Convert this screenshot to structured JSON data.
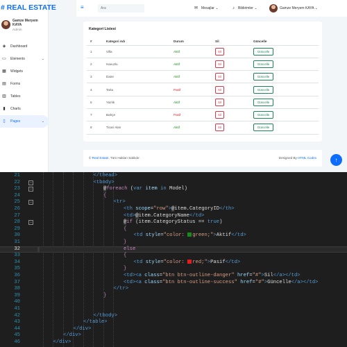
{
  "brand": "# REAL ESTATE",
  "sidebar": {
    "user_name": "Gamze Meryem KAYA",
    "user_role": "Admin",
    "items": [
      {
        "label": "Dashboard",
        "icon": "dashboard-icon"
      },
      {
        "label": "Elements",
        "icon": "laptop-icon"
      },
      {
        "label": "Widgets",
        "icon": "grid-icon"
      },
      {
        "label": "Forms",
        "icon": "keyboard-icon"
      },
      {
        "label": "Tables",
        "icon": "table-icon"
      },
      {
        "label": "Charts",
        "icon": "chart-icon"
      },
      {
        "label": "Pages",
        "icon": "file-icon"
      }
    ]
  },
  "topbar": {
    "search_placeholder": "Ara",
    "messages_label": "Mesajlar",
    "notifications_label": "Bildirimler",
    "user_label": "Gamze Meryem KAYA"
  },
  "card": {
    "title": "Kategori Listesi",
    "headers": [
      "#",
      "Kategori Adı",
      "Durum",
      "Sil",
      "Güncelle"
    ],
    "rows": [
      {
        "id": "1",
        "name": "Villa",
        "status": "Aktif",
        "active": true
      },
      {
        "id": "2",
        "name": "Havuzlu",
        "status": "Aktif",
        "active": true
      },
      {
        "id": "3",
        "name": "Daire",
        "status": "Aktif",
        "active": true
      },
      {
        "id": "4",
        "name": "Tarla",
        "status": "Pasif",
        "active": false
      },
      {
        "id": "5",
        "name": "Yazlık",
        "status": "Aktif",
        "active": true
      },
      {
        "id": "7",
        "name": "Bahçe",
        "status": "Pasif",
        "active": false
      },
      {
        "id": "8",
        "name": "Ticari Alan",
        "status": "Aktif",
        "active": true
      }
    ],
    "delete_label": "Sil",
    "update_label": "Güncelle"
  },
  "footer": {
    "copyright_prefix": "©",
    "site_link": "Real Estate",
    "rights_text": ", Tüm Hakları Saklıdır.",
    "designed_by": "Designed By",
    "designer_link": "HTML Codex"
  },
  "colors": {
    "accent": "#0d6efd",
    "active_status": "#1a8a1a",
    "passive_status": "#e02020"
  },
  "editor": {
    "current_line": "32",
    "lines": [
      {
        "n": "21",
        "fold": "",
        "tokens": [
          {
            "c": "t-tag",
            "t": "</thead>"
          }
        ]
      },
      {
        "n": "22",
        "fold": "−",
        "tokens": [
          {
            "c": "t-tag",
            "t": "<tbody>"
          }
        ]
      },
      {
        "n": "23",
        "fold": "−",
        "tokens": [
          {
            "c": "t-razor",
            "t": "@"
          },
          {
            "c": "t-kw",
            "t": "foreach"
          },
          {
            "c": "t-txt",
            "t": " ("
          },
          {
            "c": "t-tag",
            "t": "var"
          },
          {
            "c": "t-txt",
            "t": " "
          },
          {
            "c": "t-attr",
            "t": "item"
          },
          {
            "c": "t-txt",
            "t": " "
          },
          {
            "c": "t-tag",
            "t": "in"
          },
          {
            "c": "t-txt",
            "t": " Model)"
          }
        ]
      },
      {
        "n": "24",
        "fold": "",
        "tokens": [
          {
            "c": "t-kw",
            "t": "{"
          }
        ]
      },
      {
        "n": "25",
        "fold": "−",
        "tokens": [
          {
            "c": "t-tag",
            "t": "<tr>"
          }
        ]
      },
      {
        "n": "26",
        "fold": "",
        "tokens": [
          {
            "c": "t-tag",
            "t": "<th "
          },
          {
            "c": "t-attr",
            "t": "scope"
          },
          {
            "c": "t-txt",
            "t": "="
          },
          {
            "c": "t-str",
            "t": "\"row\""
          },
          {
            "c": "t-tag",
            "t": ">"
          },
          {
            "c": "t-razor",
            "t": "@"
          },
          {
            "c": "t-prop",
            "t": "item.CategoryID"
          },
          {
            "c": "t-tag",
            "t": "</th>"
          }
        ]
      },
      {
        "n": "27",
        "fold": "",
        "tokens": [
          {
            "c": "t-tag",
            "t": "<td>"
          },
          {
            "c": "t-razor",
            "t": "@"
          },
          {
            "c": "t-prop",
            "t": "item.CategoryName"
          },
          {
            "c": "t-tag",
            "t": "</td>"
          }
        ]
      },
      {
        "n": "28",
        "fold": "−",
        "tokens": [
          {
            "c": "t-razor",
            "t": "@"
          },
          {
            "c": "t-kw",
            "t": "if"
          },
          {
            "c": "t-txt",
            "t": " (item.CategoryStatus == "
          },
          {
            "c": "t-tag",
            "t": "true"
          },
          {
            "c": "t-txt",
            "t": ")"
          }
        ]
      },
      {
        "n": "29",
        "fold": "",
        "tokens": [
          {
            "c": "t-kw",
            "t": "{"
          }
        ]
      },
      {
        "n": "30",
        "fold": "",
        "tokens": [
          {
            "c": "t-tag",
            "t": "<td "
          },
          {
            "c": "t-attr",
            "t": "style"
          },
          {
            "c": "t-txt",
            "t": "="
          },
          {
            "c": "t-str",
            "t": "\"color: "
          },
          {
            "c": "swatch-green",
            "t": ""
          },
          {
            "c": "t-str",
            "t": "green;\""
          },
          {
            "c": "t-tag",
            "t": ">"
          },
          {
            "c": "t-txt",
            "t": "Aktif"
          },
          {
            "c": "t-tag",
            "t": "</td>"
          }
        ]
      },
      {
        "n": "31",
        "fold": "",
        "tokens": [
          {
            "c": "t-kw",
            "t": "}"
          }
        ]
      },
      {
        "n": "32",
        "fold": "",
        "tokens": [
          {
            "c": "t-kw",
            "t": "else"
          }
        ]
      },
      {
        "n": "33",
        "fold": "",
        "tokens": [
          {
            "c": "t-kw",
            "t": "{"
          }
        ]
      },
      {
        "n": "34",
        "fold": "",
        "tokens": [
          {
            "c": "t-tag",
            "t": "<td "
          },
          {
            "c": "t-attr",
            "t": "style"
          },
          {
            "c": "t-txt",
            "t": "="
          },
          {
            "c": "t-str",
            "t": "\"color: "
          },
          {
            "c": "swatch-red",
            "t": ""
          },
          {
            "c": "t-str",
            "t": "red;\""
          },
          {
            "c": "t-tag",
            "t": ">"
          },
          {
            "c": "t-txt",
            "t": "Pasif"
          },
          {
            "c": "t-tag",
            "t": "</td>"
          }
        ]
      },
      {
        "n": "35",
        "fold": "",
        "tokens": [
          {
            "c": "t-kw",
            "t": "}"
          }
        ]
      },
      {
        "n": "36",
        "fold": "",
        "tokens": [
          {
            "c": "t-tag",
            "t": "<td><a "
          },
          {
            "c": "t-attr",
            "t": "class"
          },
          {
            "c": "t-txt",
            "t": "="
          },
          {
            "c": "t-str",
            "t": "\"btn btn-outline-danger\""
          },
          {
            "c": "t-txt",
            "t": " "
          },
          {
            "c": "t-attr",
            "t": "href"
          },
          {
            "c": "t-txt",
            "t": "="
          },
          {
            "c": "t-str",
            "t": "\"#\""
          },
          {
            "c": "t-tag",
            "t": ">"
          },
          {
            "c": "t-txt",
            "t": "Sil"
          },
          {
            "c": "t-tag",
            "t": "</a></td>"
          }
        ]
      },
      {
        "n": "37",
        "fold": "",
        "tokens": [
          {
            "c": "t-tag",
            "t": "<td><a "
          },
          {
            "c": "t-attr",
            "t": "class"
          },
          {
            "c": "t-txt",
            "t": "="
          },
          {
            "c": "t-str",
            "t": "\"btn btn-outline-success\""
          },
          {
            "c": "t-txt",
            "t": " "
          },
          {
            "c": "t-attr",
            "t": "href"
          },
          {
            "c": "t-txt",
            "t": "="
          },
          {
            "c": "t-str",
            "t": "\"#\""
          },
          {
            "c": "t-tag",
            "t": ">"
          },
          {
            "c": "t-txt",
            "t": "Güncelle"
          },
          {
            "c": "t-tag",
            "t": "</a></td>"
          }
        ]
      },
      {
        "n": "38",
        "fold": "",
        "tokens": [
          {
            "c": "t-tag",
            "t": "</tr>"
          }
        ]
      },
      {
        "n": "39",
        "fold": "",
        "tokens": [
          {
            "c": "t-kw",
            "t": "}"
          }
        ]
      },
      {
        "n": "40",
        "fold": "",
        "tokens": []
      },
      {
        "n": "41",
        "fold": "",
        "tokens": []
      },
      {
        "n": "42",
        "fold": "",
        "tokens": [
          {
            "c": "t-tag",
            "t": "</tbody>"
          }
        ]
      },
      {
        "n": "43",
        "fold": "",
        "tokens": [
          {
            "c": "t-tag",
            "t": "</table>"
          }
        ]
      },
      {
        "n": "44",
        "fold": "",
        "tokens": [
          {
            "c": "t-tag",
            "t": "</div>"
          }
        ]
      },
      {
        "n": "45",
        "fold": "",
        "tokens": [
          {
            "c": "t-tag",
            "t": "</div>"
          }
        ]
      },
      {
        "n": "46",
        "fold": "",
        "tokens": [
          {
            "c": "t-tag",
            "t": "</div>"
          }
        ]
      }
    ]
  }
}
